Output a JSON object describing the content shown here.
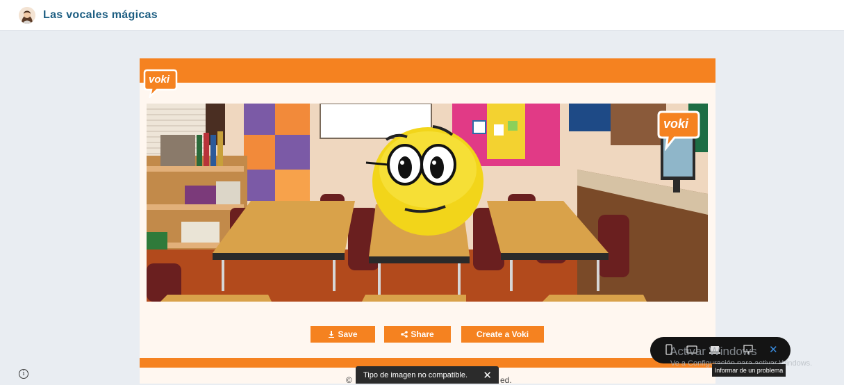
{
  "app": {
    "title": "Las vocales mágicas"
  },
  "colors": {
    "brand_orange": "#f58220",
    "title_blue": "#1d5e82",
    "background": "#e9edf2"
  },
  "voki": {
    "logo_text": "voki",
    "scene_logo_text": "voki"
  },
  "buttons": {
    "save": "Save",
    "share": "Share",
    "create": "Create a Voki"
  },
  "footer": {
    "left_fragment": "©",
    "right_fragment": "ed."
  },
  "toast": {
    "message": "Tipo de imagen no compatible.",
    "close": "✕"
  },
  "windows": {
    "watermark_title": "Activar Windows",
    "watermark_sub": "Ve a Configuración para activar Windows."
  },
  "toolbar": {
    "close": "✕",
    "tooltip": "Informar de un problema"
  },
  "icons": [
    "avatar",
    "voki-logo",
    "download-icon",
    "share-icon",
    "phone-icon",
    "tablet-icon",
    "laptop-icon",
    "desktop-icon",
    "info-icon"
  ]
}
